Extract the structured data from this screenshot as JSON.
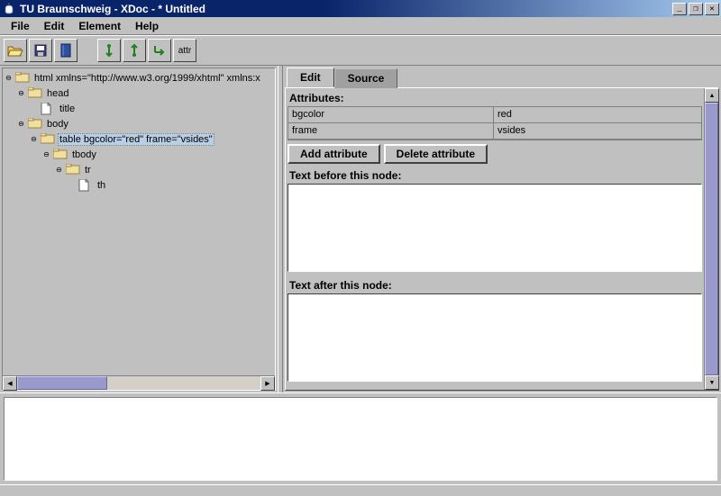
{
  "window": {
    "title": "TU Braunschweig - XDoc - * Untitled"
  },
  "menu": {
    "file": "File",
    "edit": "Edit",
    "element": "Element",
    "help": "Help"
  },
  "toolbar": {
    "attr_label": "attr"
  },
  "tree": {
    "root": "html xmlns=\"http://www.w3.org/1999/xhtml\" xmlns:x",
    "head": "head",
    "title": "title",
    "body": "body",
    "table": "table bgcolor=\"red\" frame=\"vsides\"",
    "tbody": "tbody",
    "tr": "tr",
    "th": "th"
  },
  "tabs": {
    "edit": "Edit",
    "source": "Source"
  },
  "attributes": {
    "header": "Attributes:",
    "rows": [
      {
        "name": "bgcolor",
        "value": "red"
      },
      {
        "name": "frame",
        "value": "vsides"
      }
    ],
    "add_btn": "Add attribute",
    "del_btn": "Delete attribute"
  },
  "text_before": "Text before this node:",
  "text_after": "Text after this node:"
}
